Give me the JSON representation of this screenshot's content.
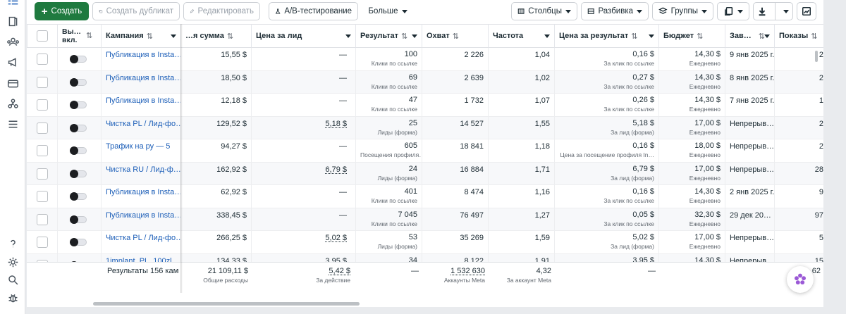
{
  "toolbar": {
    "create": "Создать",
    "duplicate": "Создать дубликат",
    "edit": "Редактировать",
    "ab_test": "A/B-тестирование",
    "more": "Больше",
    "columns": "Столбцы",
    "breakdown": "Разбивка",
    "groups": "Группы"
  },
  "headers": {
    "onoff": "Вы… вкл.",
    "campaign": "Кампания",
    "spent": "…я сумма",
    "cpl": "Цена за лид",
    "result": "Результат",
    "reach": "Охват",
    "frequency": "Частота",
    "cpr": "Цена за результат",
    "budget": "Бюджет",
    "ends": "Зав…",
    "impressions": "Показы"
  },
  "rows": [
    {
      "campaign": "Публикация в Insta…",
      "spent": "15,55 $",
      "cpl": "—",
      "result": "100",
      "result_sub": "Клики по ссылке",
      "reach": "2 226",
      "frequency": "1,04",
      "cpr": "0,16 $",
      "cpr_sub": "За клик по ссылке",
      "budget": "14,30 $",
      "budget_sub": "Ежедневно",
      "ends": "9 янв 2025 г.",
      "impressions": "2"
    },
    {
      "campaign": "Публикация в Insta…",
      "spent": "18,50 $",
      "cpl": "—",
      "result": "69",
      "result_sub": "Клики по ссылке",
      "reach": "2 639",
      "frequency": "1,02",
      "cpr": "0,27 $",
      "cpr_sub": "За клик по ссылке",
      "budget": "14,30 $",
      "budget_sub": "Ежедневно",
      "ends": "8 янв 2025 г.",
      "impressions": "2"
    },
    {
      "campaign": "Публикация в Insta…",
      "spent": "12,18 $",
      "cpl": "—",
      "result": "47",
      "result_sub": "Клики по ссылке",
      "reach": "1 732",
      "frequency": "1,07",
      "cpr": "0,26 $",
      "cpr_sub": "За клик по ссылке",
      "budget": "14,30 $",
      "budget_sub": "Ежедневно",
      "ends": "7 янв 2025 г.",
      "impressions": "1"
    },
    {
      "campaign": "Чистка PL / Лид-фо…",
      "spent": "129,52 $",
      "cpl": "5,18 $",
      "result": "25",
      "result_sub": "Лиды (форма)",
      "reach": "14 527",
      "frequency": "1,55",
      "cpr": "5,18 $",
      "cpr_sub": "За лид (форма)",
      "budget": "17,00 $",
      "budget_sub": "Ежедневно",
      "ends": "Непрерыв…",
      "impressions": "2"
    },
    {
      "campaign": "Трафик на ру — 5",
      "spent": "94,27 $",
      "cpl": "—",
      "result": "605",
      "result_sub": "Посещения профиля…",
      "reach": "18 841",
      "frequency": "1,18",
      "cpr": "0,16 $",
      "cpr_sub": "Цена за посещение профиля In…",
      "budget": "18,00 $",
      "budget_sub": "Ежедневно",
      "ends": "Непрерыв…",
      "impressions": "2"
    },
    {
      "campaign": "Чистка RU / Лид-ф…",
      "spent": "162,92 $",
      "cpl": "6,79 $",
      "result": "24",
      "result_sub": "Лиды (форма)",
      "reach": "16 884",
      "frequency": "1,71",
      "cpr": "6,79 $",
      "cpr_sub": "За лид (форма)",
      "budget": "17,00 $",
      "budget_sub": "Ежедневно",
      "ends": "Непрерыв…",
      "impressions": "28"
    },
    {
      "campaign": "Публикация в Insta…",
      "spent": "62,92 $",
      "cpl": "—",
      "result": "401",
      "result_sub": "Клики по ссылке",
      "reach": "8 474",
      "frequency": "1,16",
      "cpr": "0,16 $",
      "cpr_sub": "За клик по ссылке",
      "budget": "14,30 $",
      "budget_sub": "Ежедневно",
      "ends": "2 янв 2025 г.",
      "impressions": "9"
    },
    {
      "campaign": "Публикация в Insta…",
      "spent": "338,45 $",
      "cpl": "—",
      "result": "7 045",
      "result_sub": "Клики по ссылке",
      "reach": "76 497",
      "frequency": "1,27",
      "cpr": "0,05 $",
      "cpr_sub": "За клик по ссылке",
      "budget": "32,30 $",
      "budget_sub": "Ежедневно",
      "ends": "29 дек 20…",
      "impressions": "97"
    },
    {
      "campaign": "Чистка PL / Лид-фо…",
      "spent": "266,25 $",
      "cpl": "5,02 $",
      "result": "53",
      "result_sub": "Лиды (форма)",
      "reach": "35 269",
      "frequency": "1,59",
      "cpr": "5,02 $",
      "cpr_sub": "За лид (форма)",
      "budget": "17,00 $",
      "budget_sub": "Ежедневно",
      "ends": "Непрерыв…",
      "impressions": "5"
    },
    {
      "campaign": "1implant_PL_100zl…",
      "spent": "134,33 $",
      "cpl": "3,95 $",
      "result": "34",
      "result_sub": "",
      "reach": "8 122",
      "frequency": "1,91",
      "cpr": "3,95 $",
      "cpr_sub": "",
      "budget": "14,30 $",
      "budget_sub": "",
      "ends": "Непрерыв…",
      "impressions": "15"
    }
  ],
  "footer": {
    "label": "Результаты 156 камп…",
    "spent": "21 109,11 $",
    "spent_sub": "Общие расходы",
    "cpl": "5,42 $",
    "cpl_sub": "За действие",
    "result": "—",
    "reach": "1 532 630",
    "reach_sub": "Аккаунты Meta",
    "frequency": "4,32",
    "frequency_sub": "За аккаунт Meta",
    "cpr": "—",
    "impressions": "62"
  }
}
